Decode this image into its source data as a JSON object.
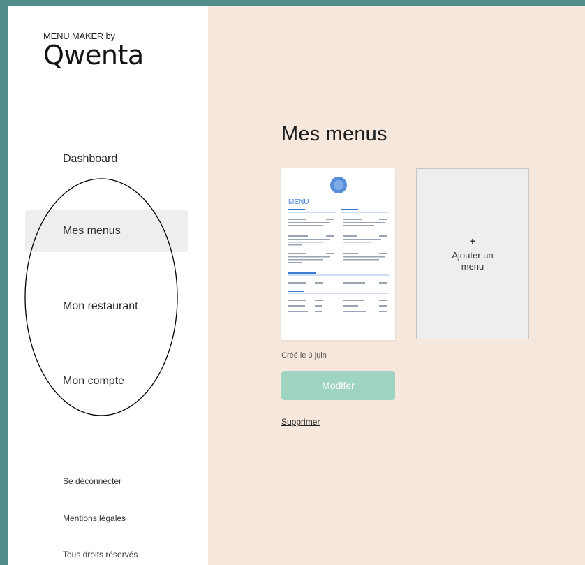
{
  "brand": {
    "top_text": "MENU MAKER by",
    "logo_text": "Qwenta"
  },
  "sidebar": {
    "items": [
      {
        "label": "Dashboard",
        "active": false
      },
      {
        "label": "Mes menus",
        "active": true
      },
      {
        "label": "Mon restaurant",
        "active": false
      },
      {
        "label": "Mon compte",
        "active": false
      }
    ],
    "footer": {
      "logout": "Se déconnecter",
      "legal": "Mentions légales",
      "rights": "Tous droits réservés"
    }
  },
  "main": {
    "title": "Mes menus",
    "menu_card": {
      "thumbnail_title": "MENU",
      "created": "Créé le 3 juin",
      "edit_label": "Modifer",
      "delete_label": "Supprimer"
    },
    "add_card": {
      "plus": "+",
      "label": "Ajouter un menu"
    }
  },
  "colors": {
    "page_frame": "#4f8c8a",
    "sidebar_bg": "#ffffff",
    "active_item_bg": "#eeeeee",
    "main_bg": "#f6e8dc",
    "button_bg": "#9fd4c2",
    "menu_accent": "#3a7bd5"
  }
}
